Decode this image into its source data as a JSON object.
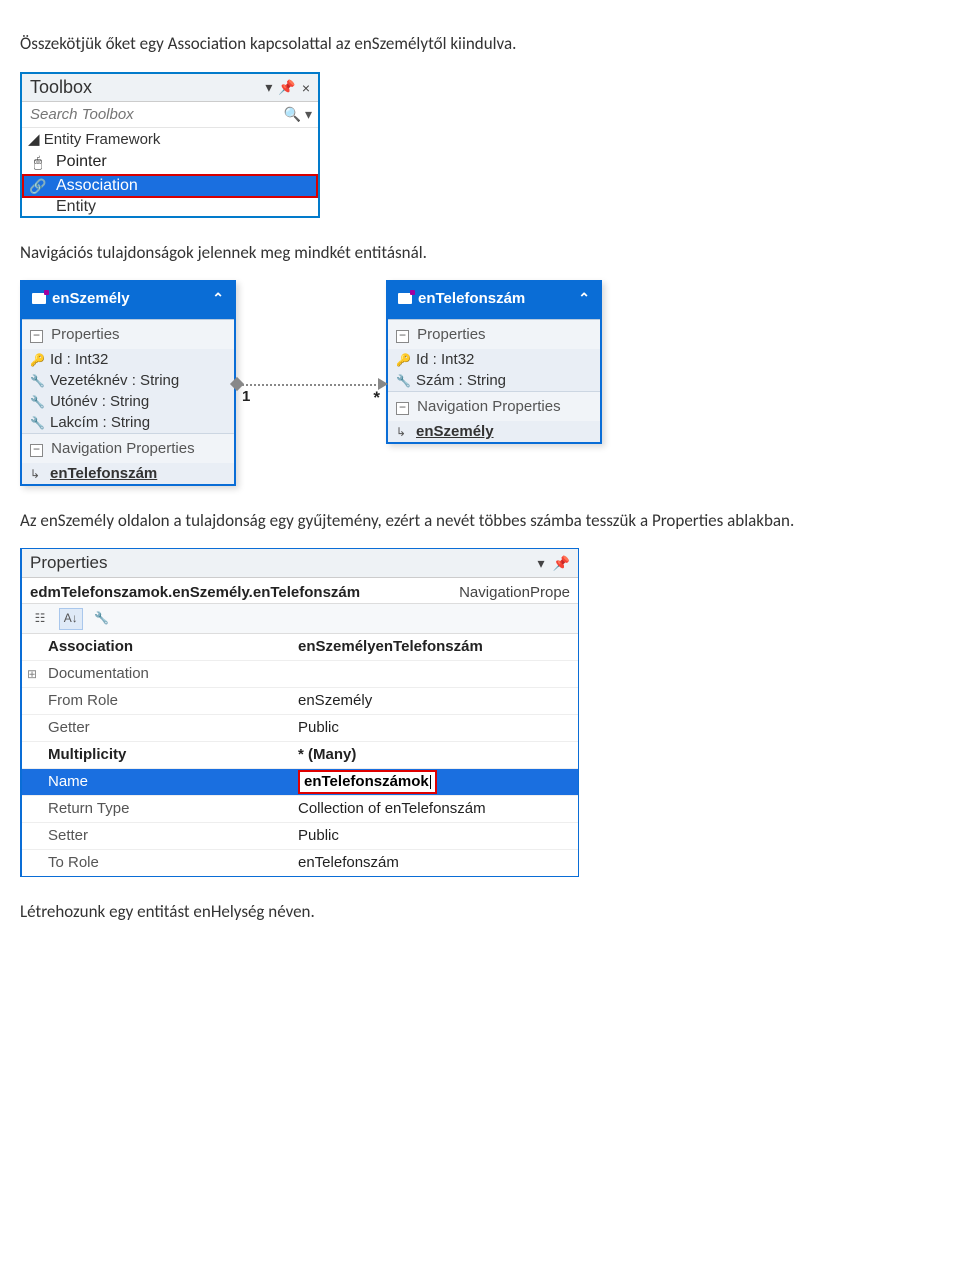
{
  "paragraphs": {
    "p1": "Összekötjük őket egy Association kapcsolattal az enSzemélytől kiindulva.",
    "p2": "Navigációs tulajdonságok jelennek meg mindkét entitásnál.",
    "p3": "Az enSzemély oldalon a tulajdonság egy gyűjtemény, ezért a nevét többes számba tesszük a Properties ablakban.",
    "p4": "Létrehozunk egy entitást enHelység néven."
  },
  "toolbox": {
    "title": "Toolbox",
    "search_placeholder": "Search Toolbox",
    "group": "Entity Framework",
    "items": {
      "pointer": "Pointer",
      "association": "Association",
      "entity": "Entity"
    }
  },
  "diagram": {
    "connector": {
      "left": "1",
      "right": "*"
    },
    "entity1": {
      "name": "enSzemély",
      "section_props": "Properties",
      "section_nav": "Navigation Properties",
      "props": {
        "p0": "Id : Int32",
        "p1": "Vezetéknév : String",
        "p2": "Utónév : String",
        "p3": "Lakcím : String"
      },
      "nav": {
        "n0": "enTelefonszám"
      }
    },
    "entity2": {
      "name": "enTelefonszám",
      "section_props": "Properties",
      "section_nav": "Navigation Properties",
      "props": {
        "p0": "Id : Int32",
        "p1": "Szám : String"
      },
      "nav": {
        "n0": "enSzemély"
      }
    }
  },
  "properties_panel": {
    "title": "Properties",
    "subject": "edmTelefonszamok.enSzemély.enTelefonszám",
    "subject_type": "NavigationPrope",
    "rows": {
      "r0": {
        "name": "Association",
        "value": "enSzemélyenTelefonszám"
      },
      "r1": {
        "name": "Documentation",
        "value": ""
      },
      "r2": {
        "name": "From Role",
        "value": "enSzemély"
      },
      "r3": {
        "name": "Getter",
        "value": "Public"
      },
      "r4": {
        "name": "Multiplicity",
        "value": "* (Many)"
      },
      "r5": {
        "name": "Name",
        "value": "enTelefonszámok"
      },
      "r6": {
        "name": "Return Type",
        "value": "Collection of enTelefonszám"
      },
      "r7": {
        "name": "Setter",
        "value": "Public"
      },
      "r8": {
        "name": "To Role",
        "value": "enTelefonszám"
      }
    }
  }
}
